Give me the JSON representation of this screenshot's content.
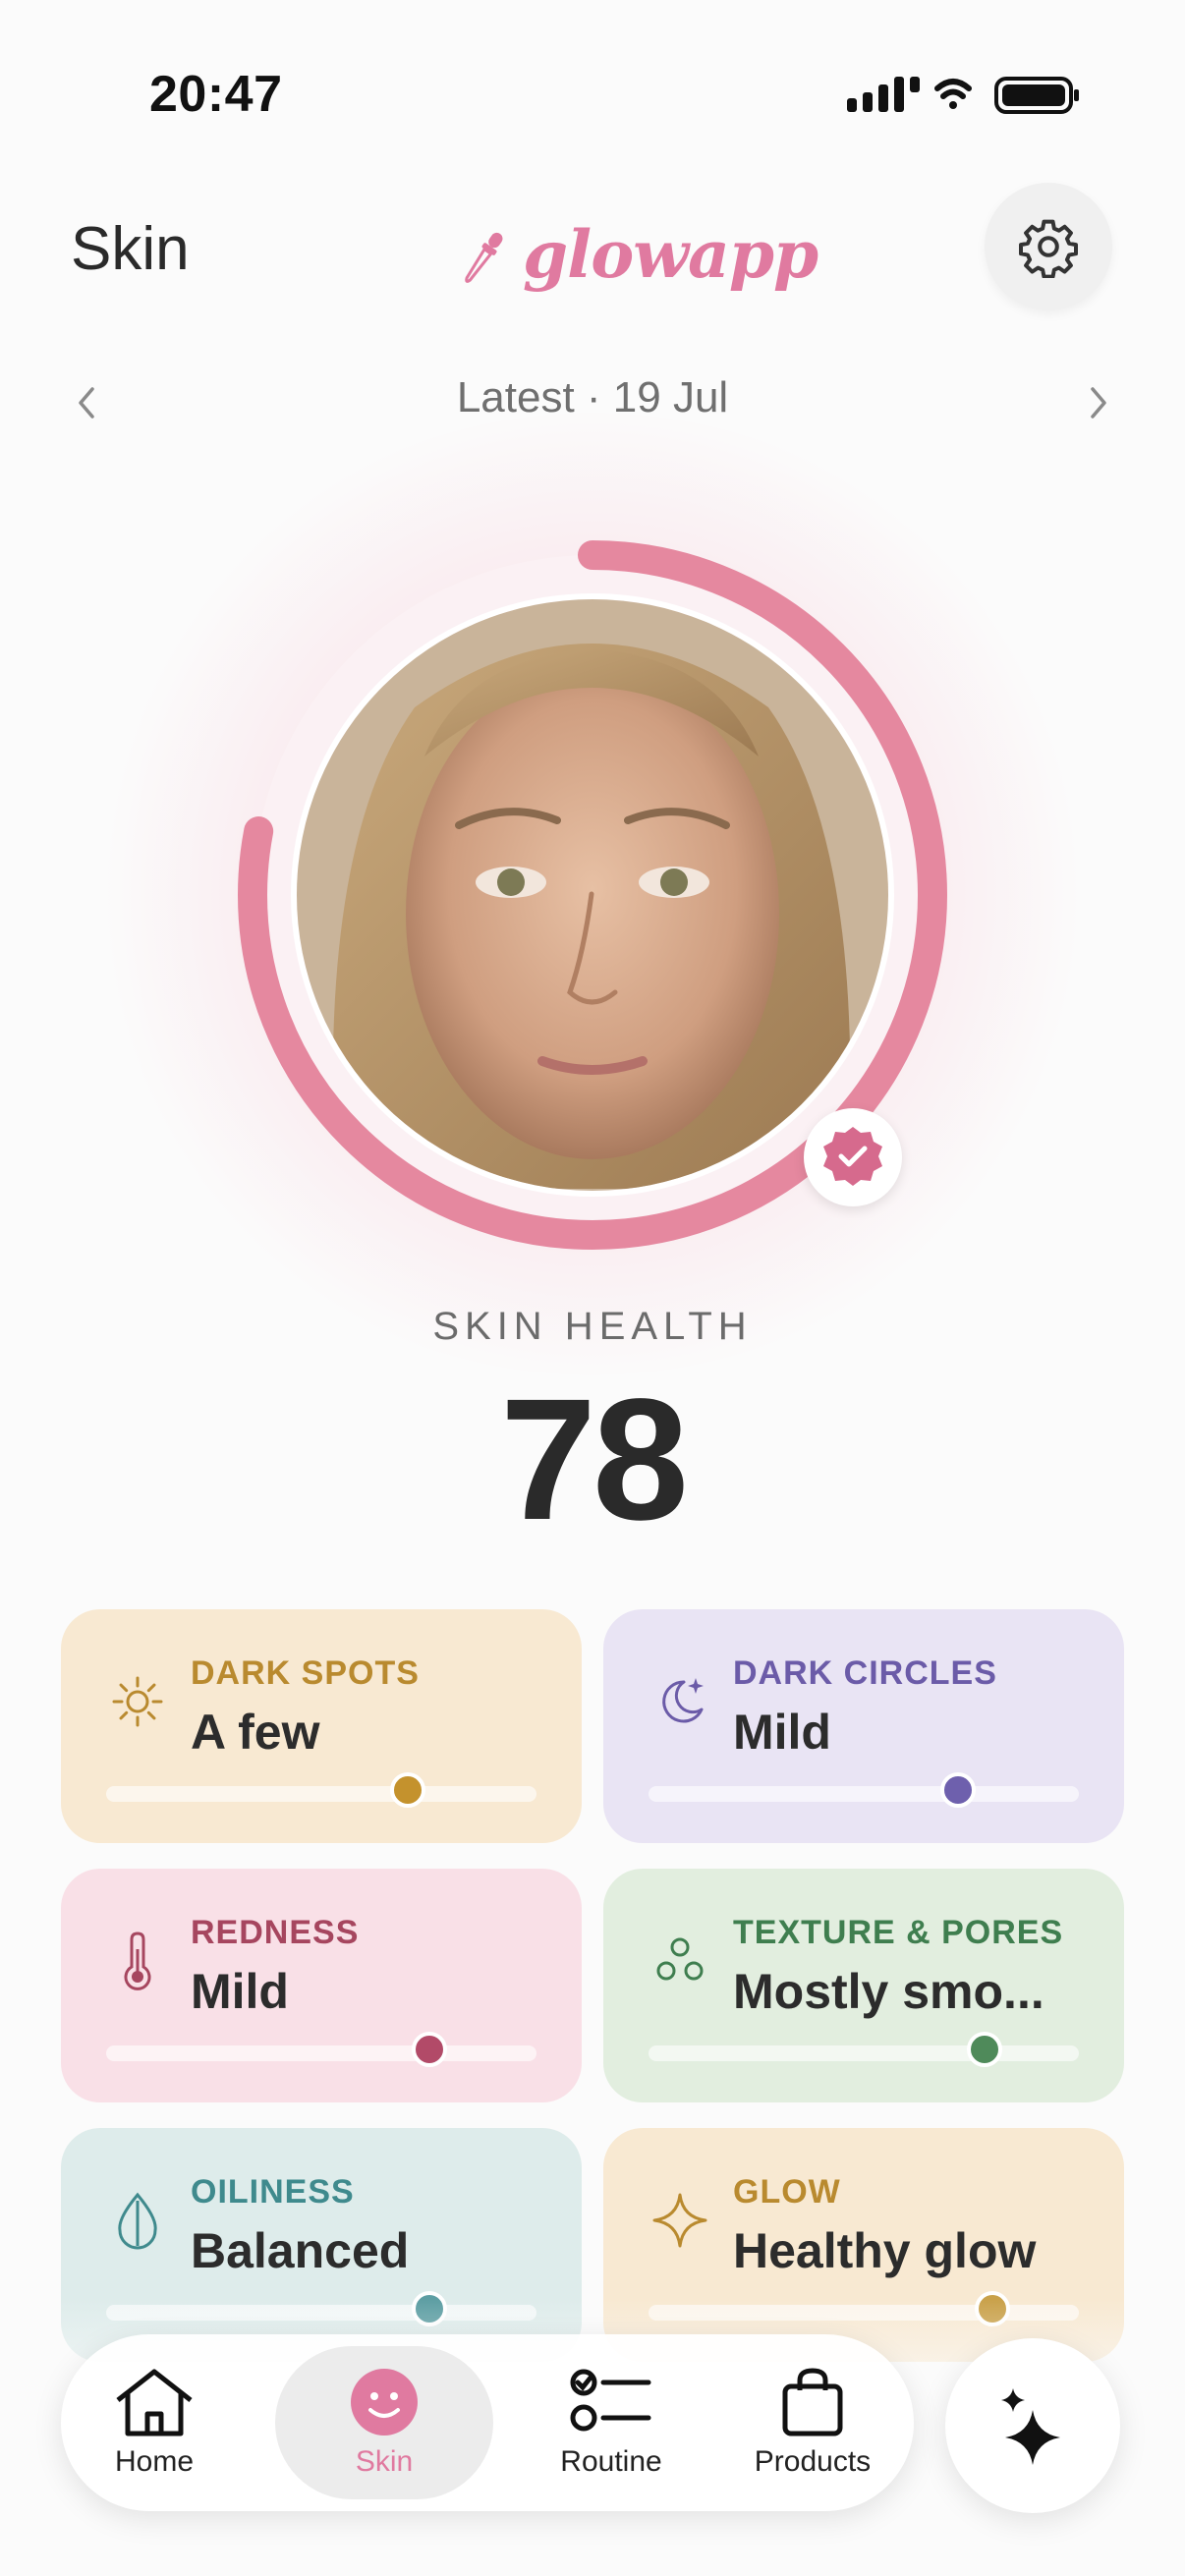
{
  "status_bar": {
    "time": "20:47"
  },
  "header": {
    "title": "Skin",
    "brand": "glowapp"
  },
  "date_nav": {
    "label": "Latest · 19 Jul"
  },
  "score": {
    "label": "SKIN HEALTH",
    "value": "78",
    "progress": 0.78
  },
  "metrics": [
    {
      "label": "DARK SPOTS",
      "value": "A few",
      "level": 0.7,
      "icon": "sun-icon",
      "bg": "#f8e9d2",
      "accent": "#b98a2f",
      "knob": "#c4922d"
    },
    {
      "label": "DARK CIRCLES",
      "value": "Mild",
      "level": 0.72,
      "icon": "moon-stars-icon",
      "bg": "#e9e4f4",
      "accent": "#6b5ba8",
      "knob": "#6e60ad"
    },
    {
      "label": "REDNESS",
      "value": "Mild",
      "level": 0.75,
      "icon": "thermometer-icon",
      "bg": "#f9e0e7",
      "accent": "#a6465f",
      "knob": "#b24a68"
    },
    {
      "label": "TEXTURE & PORES",
      "value": "Mostly smo...",
      "level": 0.78,
      "icon": "bubbles-icon",
      "bg": "#e2eedf",
      "accent": "#3f7e4f",
      "knob": "#4f8a5a"
    },
    {
      "label": "OILINESS",
      "value": "Balanced",
      "level": 0.75,
      "icon": "drop-icon",
      "bg": "#deeceb",
      "accent": "#3f8a8d",
      "knob": "#5d9ea3"
    },
    {
      "label": "GLOW",
      "value": "Healthy glow",
      "level": 0.8,
      "icon": "sparkle-icon",
      "bg": "#f8e9d2",
      "accent": "#b98a2f",
      "knob": "#c9a14a"
    }
  ],
  "tabs": [
    {
      "label": "Home",
      "icon": "home-icon"
    },
    {
      "label": "Skin",
      "icon": "smiley-icon",
      "active": true
    },
    {
      "label": "Routine",
      "icon": "checklist-icon"
    },
    {
      "label": "Products",
      "icon": "shopping-bag-icon"
    }
  ],
  "colors": {
    "brand": "#e07aa0",
    "ring": "#e5889f",
    "ring_track": "#f6dbe3"
  }
}
